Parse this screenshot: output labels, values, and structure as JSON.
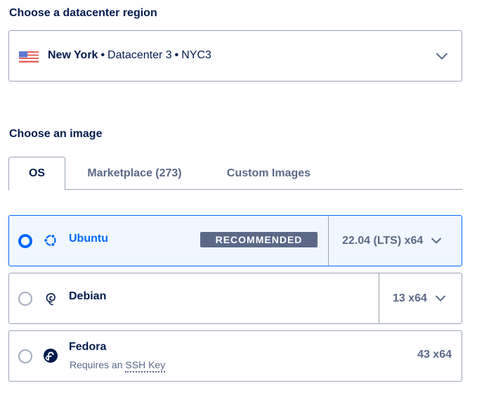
{
  "region": {
    "title": "Choose a datacenter region",
    "city": "New York",
    "datacenter": "Datacenter 3",
    "code": "NYC3",
    "separator": "•",
    "flag_icon": "us-flag-icon",
    "dropdown_icon": "chevron-down-icon"
  },
  "image": {
    "title": "Choose an image",
    "tabs": [
      {
        "label": "OS",
        "active": true
      },
      {
        "label": "Marketplace (273)",
        "active": false
      },
      {
        "label": "Custom Images",
        "active": false
      }
    ],
    "os_options": [
      {
        "name": "Ubuntu",
        "icon": "ubuntu-icon",
        "badge": "RECOMMENDED",
        "version": "22.04 (LTS) x64",
        "selected": true
      },
      {
        "name": "Debian",
        "icon": "debian-icon",
        "version": "13 x64",
        "selected": false
      },
      {
        "name": "Fedora",
        "icon": "fedora-icon",
        "note_prefix": "Requires an",
        "note_link": "SSH Key",
        "version": "43 x64",
        "selected": false
      }
    ]
  },
  "colors": {
    "accent": "#0069ff",
    "text": "#031b4e",
    "muted": "#5b6987",
    "border": "#99a3b6",
    "selected_bg": "#f1f7ff"
  }
}
